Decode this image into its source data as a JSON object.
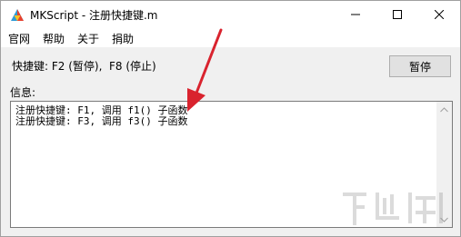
{
  "window": {
    "title": "MKScript - 注册快捷键.m"
  },
  "menu": {
    "items": [
      {
        "label": "官网"
      },
      {
        "label": "帮助"
      },
      {
        "label": "关于"
      },
      {
        "label": "捐助"
      }
    ]
  },
  "hotkeys": {
    "label": "快捷键: F2 (暂停),  F8 (停止)"
  },
  "toolbar": {
    "pause_label": "暂停"
  },
  "info": {
    "label": "信息:",
    "lines": [
      "注册快捷键: F1, 调用 f1() 子函数",
      "注册快捷键: F3, 调用 f3() 子函数"
    ]
  },
  "icons": {
    "app": "app-logo-icon",
    "minimize": "minimize-icon",
    "maximize": "maximize-icon",
    "close": "close-icon",
    "scroll_up": "chevron-up-icon",
    "scroll_down": "chevron-down-icon",
    "annotation": "red-arrow-icon"
  },
  "colors": {
    "annotation_arrow": "#d9232e",
    "window_bg": "#f0f0f0",
    "button_bg": "#e1e1e1"
  },
  "watermark": {
    "text": "下载吧"
  }
}
